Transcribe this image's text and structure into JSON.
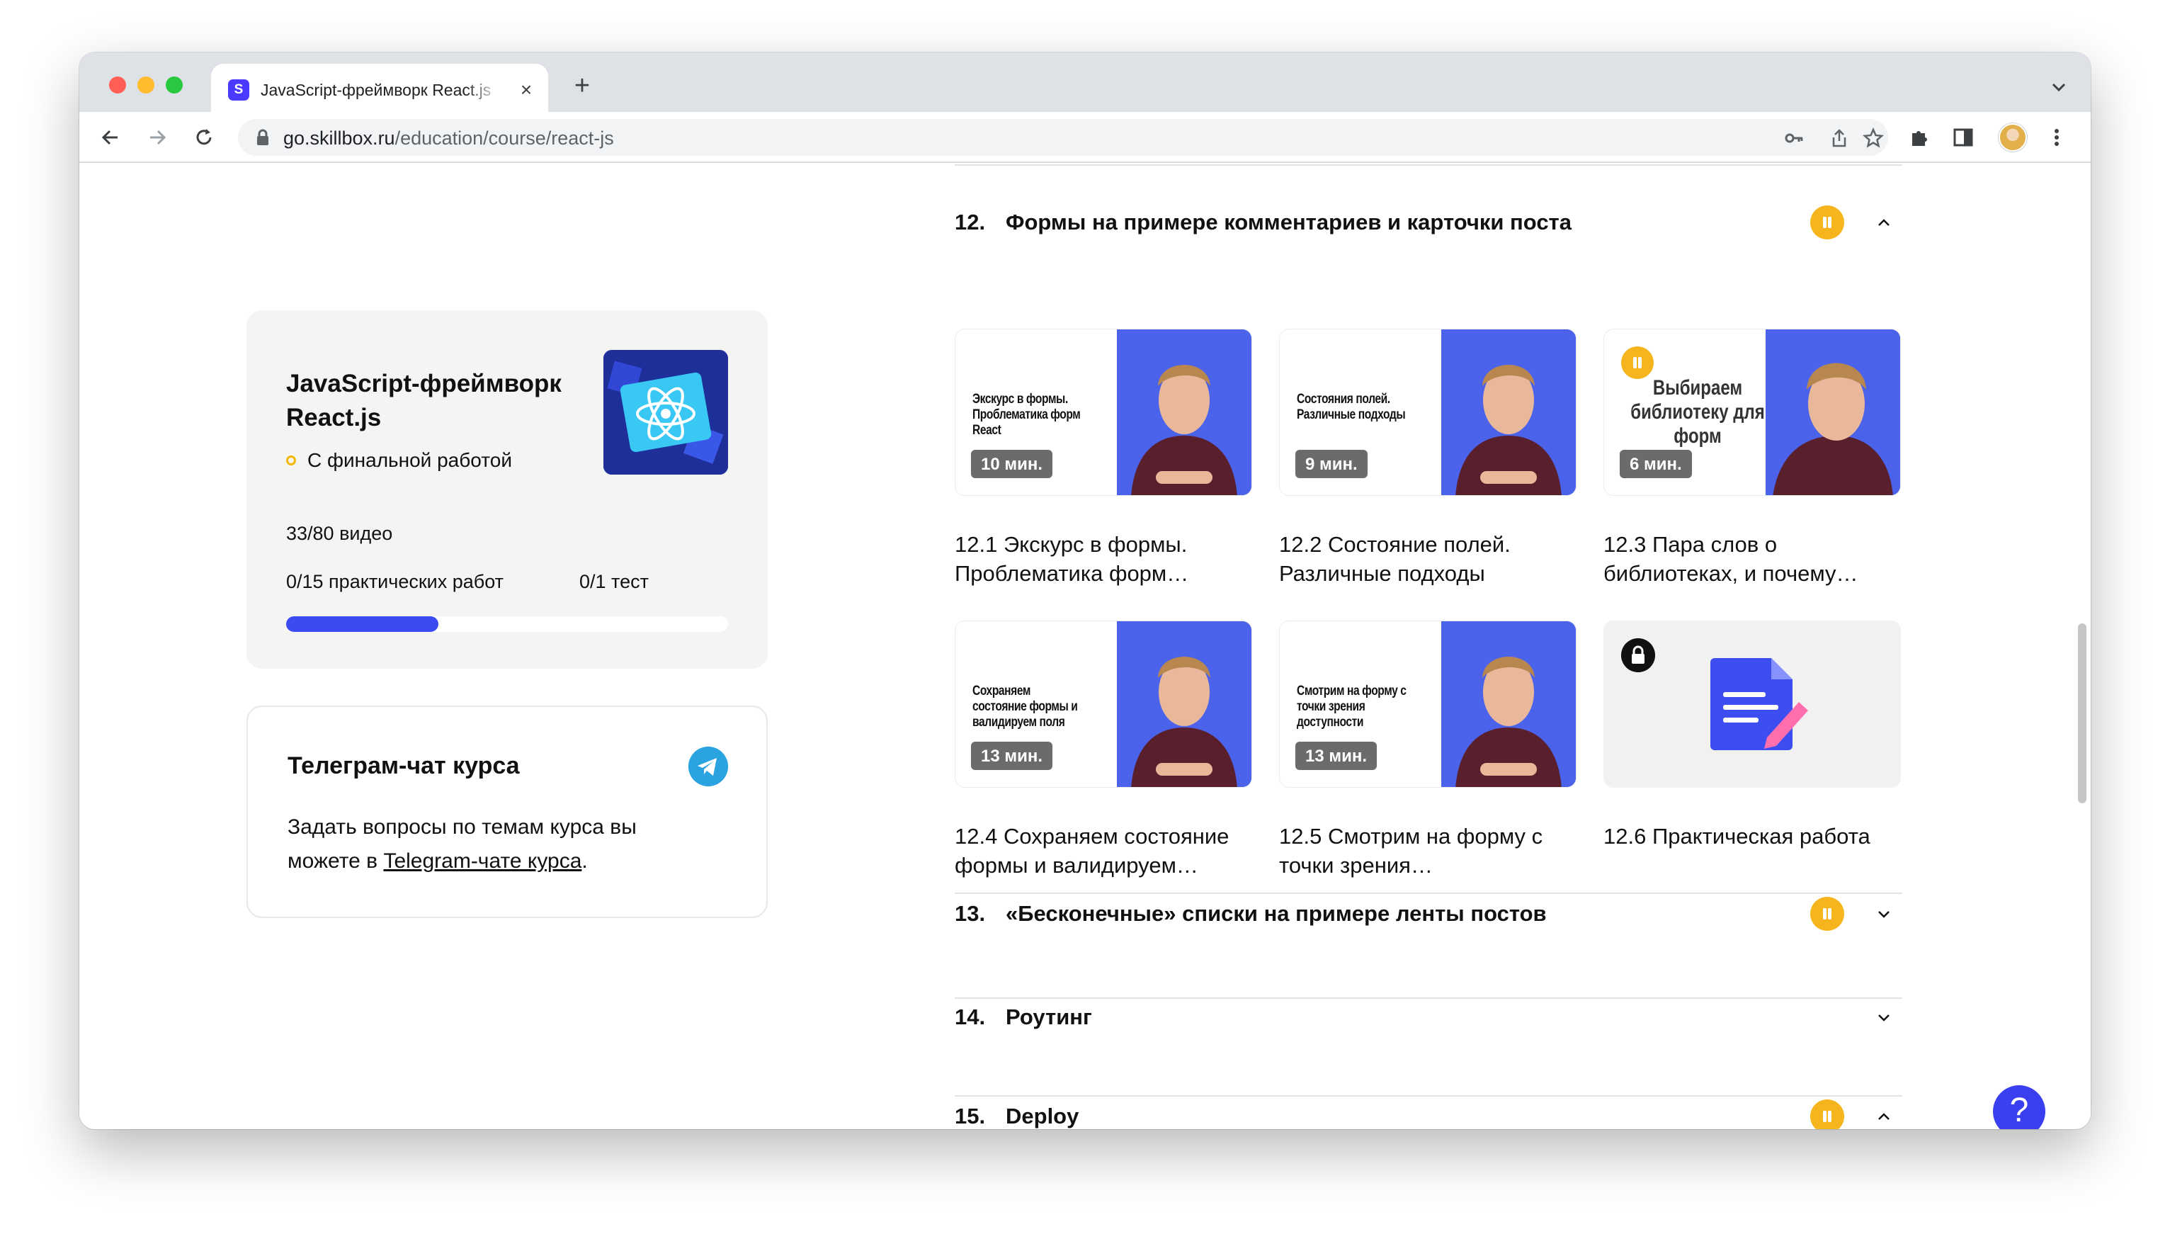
{
  "browser": {
    "tab_title": "JavaScript-фреймворк React.js",
    "tab_favicon_letter": "S",
    "url_domain": "go.skillbox.ru",
    "url_path": "/education/course/react-js"
  },
  "course_card": {
    "title": "JavaScript-фреймворк React.js",
    "badge": "С финальной работой",
    "videos": "33/80 видео",
    "practice": "0/15 практических работ",
    "tests": "0/1 тест",
    "progress_fraction": 0.344
  },
  "telegram_card": {
    "title": "Телеграм-чат курса",
    "text_before": "Задать вопросы по темам курса вы можете в ",
    "link_text": "Telegram-чате курса",
    "text_after": "."
  },
  "sections": [
    {
      "num": "12.",
      "title": "Формы на примере комментариев и карточки поста",
      "paused": true,
      "expanded": true
    },
    {
      "num": "13.",
      "title": "«Бесконечные» списки на примере ленты постов",
      "paused": true,
      "expanded": false
    },
    {
      "num": "14.",
      "title": "Роутинг",
      "paused": false,
      "expanded": false
    },
    {
      "num": "15.",
      "title": "Deploy",
      "paused": true,
      "expanded": true
    }
  ],
  "lessons": [
    {
      "title": "12.1 Экскурс в формы. Проблематика форм…",
      "duration": "10 мин.",
      "slide_text": "Экскурс в формы. Проблематика форм React"
    },
    {
      "title": "12.2 Состояние полей. Различные подходы",
      "duration": "9 мин.",
      "slide_text": "Состояния полей. Различные подходы"
    },
    {
      "title": "12.3 Пара слов о библиотеках, и почему…",
      "duration": "6 мин.",
      "slide_text": "Выбираем библиотеку для форм"
    },
    {
      "title": "12.4 Сохраняем состояние формы и валидируем…",
      "duration": "13 мин.",
      "slide_text": "Сохраняем состояние формы и валидируем поля"
    },
    {
      "title": "12.5 Смотрим на форму с точки зрения…",
      "duration": "13 мин.",
      "slide_text": "Смотрим на форму с точки зрения доступности"
    },
    {
      "title": "12.6 Практическая работа"
    }
  ],
  "help_button": "?",
  "colors": {
    "accent": "#3a4bf1",
    "pause": "#f7b51d",
    "telegram": "#2aa3e0"
  }
}
